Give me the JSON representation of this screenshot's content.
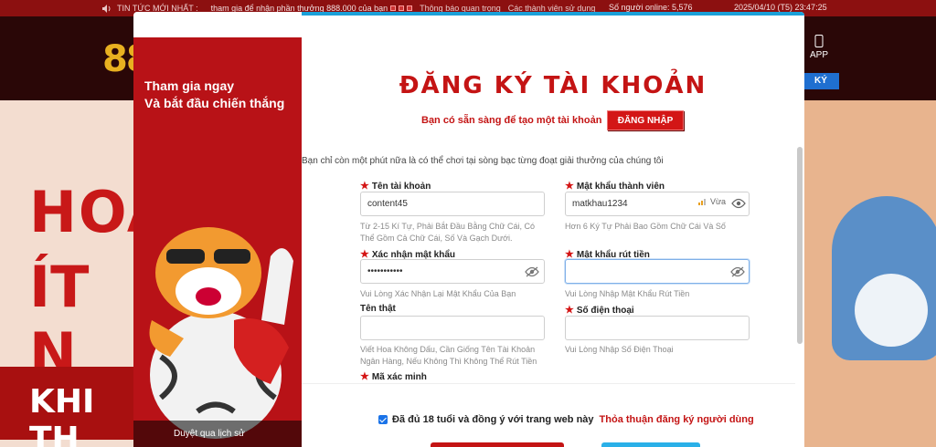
{
  "ticker": {
    "label": "TIN TỨC MỚI NHẤT :",
    "news1": "tham gia để nhận phần thưởng 888.000 của bạn",
    "news2": "Thông báo quan trọng",
    "news3": "Các thành viên sử dụng",
    "online": "Số người online: 5,576",
    "datetime": "2025/04/10 (T5) 23:47:25"
  },
  "header": {
    "logo": "88",
    "app_label": "APP",
    "register_partial": "KÝ"
  },
  "background": {
    "left_line1": "HOÀ",
    "left_line2": "ÍT N",
    "left_line3": "KHI TH"
  },
  "promo": {
    "headline1": "Tham gia ngay",
    "headline2": "Và bắt đầu chiến thắng",
    "caption": "Duyệt qua lịch sử"
  },
  "form": {
    "title": "ĐĂNG KÝ TÀI KHOẢN",
    "subtitle": "Bạn có sẵn sàng để tạo một tài khoản",
    "login_button": "ĐĂNG NHẬP",
    "note": "Bạn chỉ còn một phút nữa là có thể chơi tại sòng bạc từng đoạt giải thưởng của chúng tôi",
    "username": {
      "label": "Tên tài khoản",
      "value": "content45",
      "hint1": "Từ 2-15 Kí Tự, Phải Bắt Đầu Bằng Chữ Cái, Có",
      "hint2": "Thể Gồm Cả Chữ Cái, Số Và Gạch Dưới."
    },
    "password": {
      "label": "Mật khẩu thành viên",
      "value": "matkhau1234",
      "strength": "Vừa",
      "hint": "Hơn 6 Ký Tự Phải Bao Gồm Chữ Cái Và Số"
    },
    "confirm": {
      "label": "Xác nhận mật khẩu",
      "value": "•••••••••••",
      "hint": "Vui Lòng Xác Nhận Lại Mật Khẩu Của Bạn"
    },
    "withdraw": {
      "label": "Mật khẩu rút tiền",
      "value": "",
      "hint": "Vui Lòng Nhập Mật Khẩu Rút Tiền"
    },
    "realname": {
      "label": "Tên thật",
      "value": "",
      "hint1": "Viết Hoa Không Dấu, Cần Giống Tên Tài Khoản",
      "hint2": "Ngân Hàng, Nếu Không Thì Không Thể Rút Tiền"
    },
    "phone": {
      "label": "Số điện thoại",
      "value": "",
      "hint": "Vui Lòng Nhập Số Điện Thoại"
    },
    "captcha": {
      "label": "Mã xác minh"
    },
    "agree_text": "Đã đủ 18 tuổi và đồng ý với trang web này",
    "agree_link": "Thỏa thuận đăng ký người dùng"
  },
  "colors": {
    "brand_red": "#c41414",
    "accent_blue": "#1aa0d8"
  }
}
